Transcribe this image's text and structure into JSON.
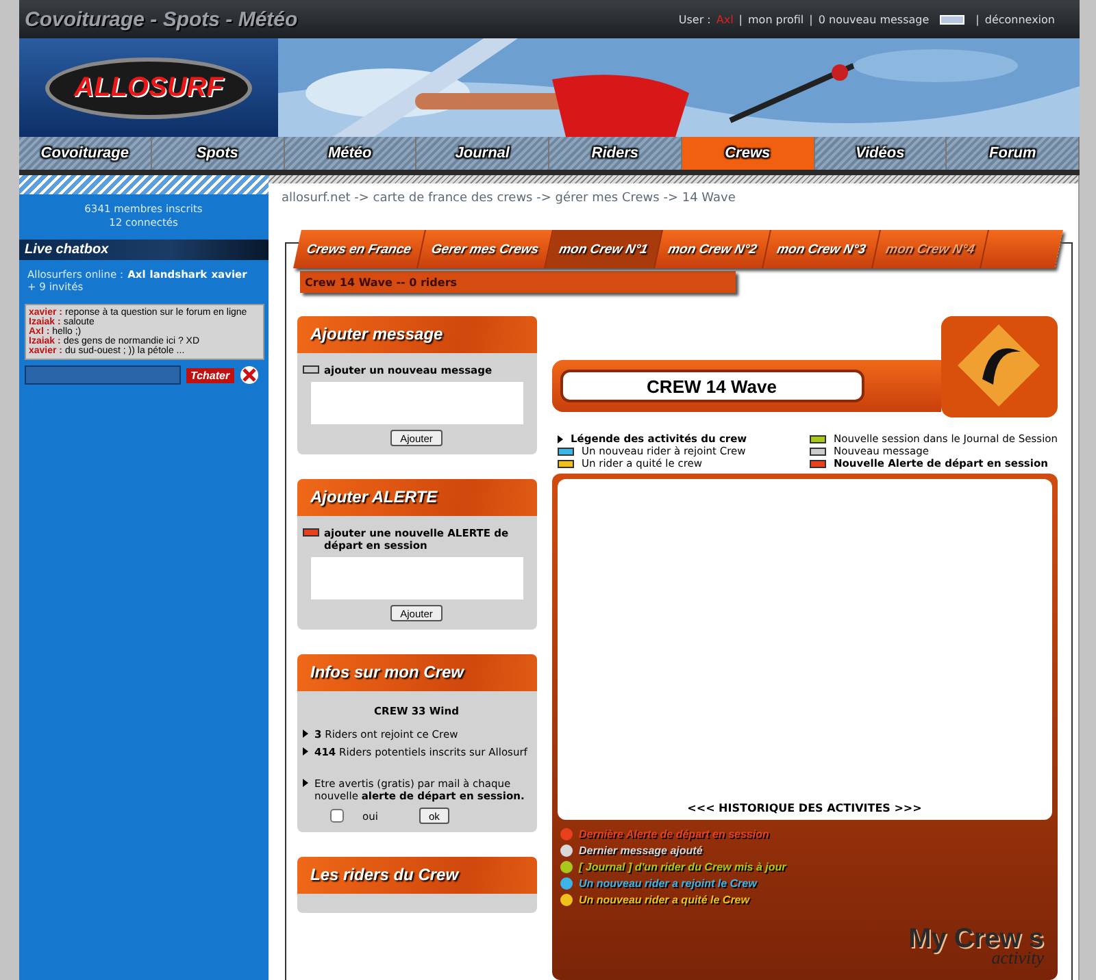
{
  "top_bar": {
    "title": "Covoiturage - Spots - Météo",
    "user_label": "User :",
    "user": "Axl",
    "links": [
      "mon profil",
      "0 nouveau message",
      "déconnexion"
    ],
    "separator": "|"
  },
  "logo": {
    "name": "ALLOSURF"
  },
  "nav": [
    {
      "label": "Covoiturage",
      "selected": false
    },
    {
      "label": "Spots",
      "selected": false
    },
    {
      "label": "Météo",
      "selected": false
    },
    {
      "label": "Journal",
      "selected": false
    },
    {
      "label": "Riders",
      "selected": false
    },
    {
      "label": "Crews",
      "selected": true
    },
    {
      "label": "Vidéos",
      "selected": false
    },
    {
      "label": "Forum",
      "selected": false
    }
  ],
  "sidebar": {
    "members": "6341 membres inscrits",
    "connected": "12 connectés",
    "chatbox_title": "Live chatbox",
    "online_label": "Allosurfers online :",
    "online": [
      "Axl",
      "landshark",
      "xavier"
    ],
    "guests": "+ 9 invités",
    "messages": [
      {
        "author": "xavier :",
        "text": "reponse à ta question sur le forum en ligne"
      },
      {
        "author": "Izaiak :",
        "text": "saloute"
      },
      {
        "author": "Axl :",
        "text": "hello ;)"
      },
      {
        "author": "Izaiak :",
        "text": "des gens de normandie ici ? XD"
      },
      {
        "author": "xavier :",
        "text": "du sud-ouest ; )) la pétole ..."
      }
    ],
    "send": "Tchater"
  },
  "breadcrumb": "allosurf.net -> carte de france des crews -> gérer mes Crews -> 14 Wave",
  "crew_tabs": [
    {
      "label": "Crews en France",
      "selected": false,
      "disabled": false
    },
    {
      "label": "Gerer mes Crews",
      "selected": false,
      "disabled": false
    },
    {
      "label": "mon Crew N°1",
      "selected": true,
      "disabled": false
    },
    {
      "label": "mon Crew N°2",
      "selected": false,
      "disabled": false
    },
    {
      "label": "mon Crew N°3",
      "selected": false,
      "disabled": false
    },
    {
      "label": "mon Crew N°4",
      "selected": false,
      "disabled": true
    }
  ],
  "crew_bar": "Crew 14 Wave -- 0 riders",
  "panels": [
    {
      "kind": "compose",
      "title": "Ajouter message",
      "label": "ajouter un nouveau message",
      "color": "#cccccc",
      "button": "Ajouter"
    },
    {
      "kind": "compose",
      "title": "Ajouter ALERTE",
      "label": "ajouter une nouvelle ALERTE de départ en session",
      "color": "#e8401c",
      "button": "Ajouter"
    },
    {
      "kind": "info",
      "title": "Infos sur mon Crew",
      "crew": "CREW 33 Wind",
      "facts": [
        "**3** Riders ont rejoint ce Crew",
        "**414** Riders potentiels inscrits sur Allosurf"
      ],
      "notify": "Etre avertis (gratis) par mail à chaque nouvelle **alerte de départ en session.**",
      "checkbox_label": "oui",
      "checked": false,
      "button": "ok"
    },
    {
      "kind": "empty",
      "title": "Les riders du Crew"
    }
  ],
  "crew_title": "CREW 14 Wave",
  "legend": {
    "title": "Légende des activités du crew",
    "items": [
      {
        "label": "Nouvelle session dans le Journal de Session",
        "color": "#a8c81c",
        "bold": false
      },
      {
        "label": "Un nouveau rider à rejoint Crew",
        "color": "#3cb4e8",
        "bold": false
      },
      {
        "label": "Nouveau message",
        "color": "#cccccc",
        "bold": false
      },
      {
        "label": "Un rider a quité le crew",
        "color": "#f0c01c",
        "bold": false
      },
      {
        "label": "Nouvelle Alerte de départ en session",
        "color": "#e8401c",
        "bold": true
      }
    ]
  },
  "history": "<<< HISTORIQUE DES ACTIVITES >>>",
  "activity_legend": [
    {
      "label": "Dernière Alerte de départ en session",
      "color": "#e8401c"
    },
    {
      "label": "Dernier message ajouté",
      "color": "#d8d8d8"
    },
    {
      "label": "[ Journal ]  d'un rider  du Crew mis à jour",
      "color": "#a8c81c"
    },
    {
      "label": "Un nouveau rider a rejoint le Crew",
      "color": "#3cb4e8"
    },
    {
      "label": "Un nouveau rider a quité le Crew",
      "color": "#f0c01c"
    }
  ],
  "activity_logo": {
    "title": "My Crew s",
    "subtitle": "activity"
  }
}
